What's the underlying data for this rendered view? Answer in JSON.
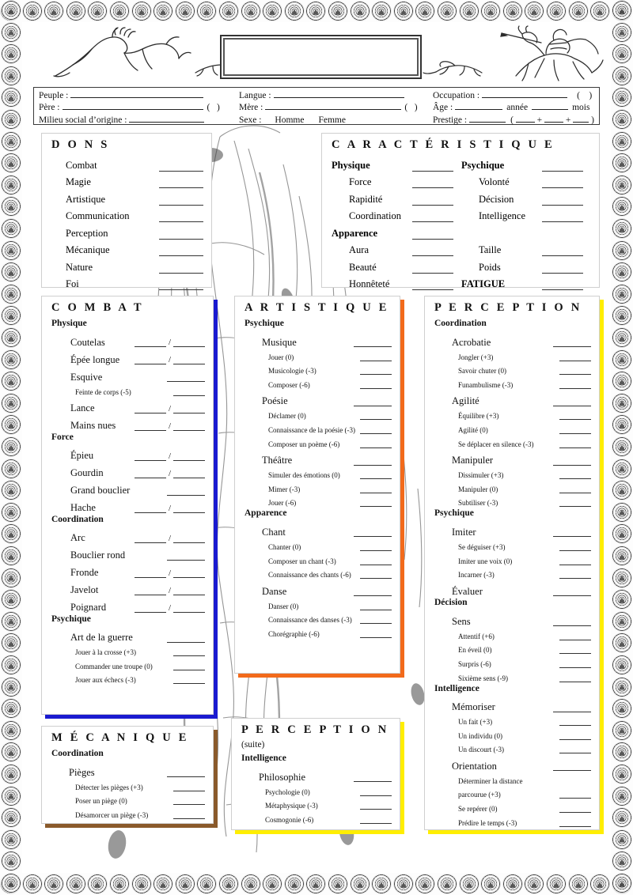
{
  "header": {
    "title_box_text": "",
    "art_left": "running-stag-line-art",
    "art_center_small": "running-dogs-line-art",
    "art_right": "mounted-knight-line-art"
  },
  "identity": {
    "rows": [
      [
        {
          "label": "Peuple :",
          "blank": "long"
        },
        {
          "label": "Langue :",
          "blank": "long"
        },
        {
          "label": "Occupation :",
          "blank": "med",
          "paren": true
        }
      ],
      [
        {
          "label": "Père :",
          "blank": "long",
          "paren": true
        },
        {
          "label": "Mère :",
          "blank": "long",
          "paren": true
        },
        {
          "label": "Âge :",
          "blank": "short",
          "suffix1": "année",
          "suffix2": "mois"
        }
      ],
      [
        {
          "label": "Milieu social d’origine :",
          "blank": "med"
        },
        {
          "label": "Sexe :",
          "options": [
            "Homme",
            "Femme"
          ]
        },
        {
          "label": "Prestige :",
          "formula": "( ___ + ___ + ___ )"
        }
      ]
    ],
    "sexe_label": "Sexe :",
    "sexe_options": [
      "Homme",
      "Femme"
    ],
    "annee": "année",
    "mois": "mois",
    "prestige_label": "Prestige :"
  },
  "dons": {
    "title": "D O N S",
    "items": [
      "Combat",
      "Magie",
      "Artistique",
      "Communication",
      "Perception",
      "Mécanique",
      "Nature",
      "Foi"
    ]
  },
  "caracteristique": {
    "title": "C A R A C T É R I S T I Q U E",
    "rows": [
      {
        "left": "Physique",
        "left_bold": true,
        "left_indent": false,
        "right": "Psychique",
        "right_bold": true,
        "right_indent": false,
        "right_blank": true
      },
      {
        "left": "Force",
        "left_bold": false,
        "left_indent": true,
        "right": "Volonté",
        "right_bold": false,
        "right_indent": true,
        "right_blank": true
      },
      {
        "left": "Rapidité",
        "left_bold": false,
        "left_indent": true,
        "right": "Décision",
        "right_bold": false,
        "right_indent": true,
        "right_blank": true
      },
      {
        "left": "Coordination",
        "left_bold": false,
        "left_indent": true,
        "right": "Intelligence",
        "right_bold": false,
        "right_indent": true,
        "right_blank": true
      },
      {
        "left": "Apparence",
        "left_bold": true,
        "left_indent": false,
        "right": "",
        "right_bold": false,
        "right_indent": false,
        "right_blank": false
      },
      {
        "left": "Aura",
        "left_bold": false,
        "left_indent": true,
        "right": "Taille",
        "right_bold": false,
        "right_indent": true,
        "right_blank": true
      },
      {
        "left": "Beauté",
        "left_bold": false,
        "left_indent": true,
        "right": "Poids",
        "right_bold": false,
        "right_indent": true,
        "right_blank": true
      },
      {
        "left": "Honnêteté",
        "left_bold": false,
        "left_indent": true,
        "right": "FATIGUE",
        "right_bold": true,
        "right_indent": false,
        "right_blank": true
      }
    ]
  },
  "combat": {
    "title": "C O M B A T",
    "shadow_color": "#1a1ad0",
    "groups": [
      {
        "name": "Physique",
        "entries": [
          {
            "label": "Coutelas",
            "level": 1,
            "dual": true
          },
          {
            "label": "Épée longue",
            "level": 1,
            "dual": true
          },
          {
            "label": "Esquive",
            "level": 1,
            "dual": false
          },
          {
            "label": "Feinte de corps (-5)",
            "level": 2,
            "dual": false
          },
          {
            "label": "Lance",
            "level": 1,
            "dual": true
          },
          {
            "label": "Mains nues",
            "level": 1,
            "dual": true
          }
        ]
      },
      {
        "name": "Force",
        "entries": [
          {
            "label": "Épieu",
            "level": 1,
            "dual": true
          },
          {
            "label": "Gourdin",
            "level": 1,
            "dual": true
          },
          {
            "label": "Grand bouclier",
            "level": 1,
            "dual": false
          },
          {
            "label": "Hache",
            "level": 1,
            "dual": true
          }
        ]
      },
      {
        "name": "Coordination",
        "entries": [
          {
            "label": "Arc",
            "level": 1,
            "dual": true
          },
          {
            "label": "Bouclier rond",
            "level": 1,
            "dual": false
          },
          {
            "label": "Fronde",
            "level": 1,
            "dual": true
          },
          {
            "label": "Javelot",
            "level": 1,
            "dual": true
          },
          {
            "label": "Poignard",
            "level": 1,
            "dual": true
          }
        ]
      },
      {
        "name": "Psychique",
        "entries": [
          {
            "label": "Art de la guerre",
            "level": 1,
            "dual": false
          },
          {
            "label": "Jouer à la crosse (+3)",
            "level": 2,
            "dual": false
          },
          {
            "label": "Commander une troupe (0)",
            "level": 2,
            "dual": false
          },
          {
            "label": "Jouer aux échecs (-3)",
            "level": 2,
            "dual": false
          }
        ]
      }
    ]
  },
  "artistique": {
    "title": "A R T I S T I Q U E",
    "shadow_color": "#f26a1b",
    "groups": [
      {
        "name": "Psychique",
        "entries": [
          {
            "label": "Musique",
            "level": 1,
            "dual": false
          },
          {
            "label": "Jouer (0)",
            "level": 2,
            "dual": false
          },
          {
            "label": "Musicologie (-3)",
            "level": 2,
            "dual": false
          },
          {
            "label": "Composer (-6)",
            "level": 2,
            "dual": false
          },
          {
            "label": "Poésie",
            "level": 1,
            "dual": false
          },
          {
            "label": "Déclamer (0)",
            "level": 2,
            "dual": false
          },
          {
            "label": "Connaissance de la poésie (-3)",
            "level": 2,
            "dual": false
          },
          {
            "label": "Composer un poème (-6)",
            "level": 2,
            "dual": false
          },
          {
            "label": "Théâtre",
            "level": 1,
            "dual": false
          },
          {
            "label": "Simuler des émotions (0)",
            "level": 2,
            "dual": false
          },
          {
            "label": "Mimer (-3)",
            "level": 2,
            "dual": false
          },
          {
            "label": "Jouer (-6)",
            "level": 2,
            "dual": false
          }
        ]
      },
      {
        "name": "Apparence",
        "entries": [
          {
            "label": "Chant",
            "level": 1,
            "dual": false
          },
          {
            "label": "Chanter (0)",
            "level": 2,
            "dual": false
          },
          {
            "label": "Composer un chant (-3)",
            "level": 2,
            "dual": false
          },
          {
            "label": "Connaissance des chants (-6)",
            "level": 2,
            "dual": false
          },
          {
            "label": "Danse",
            "level": 1,
            "dual": false
          },
          {
            "label": "Danser (0)",
            "level": 2,
            "dual": false
          },
          {
            "label": "Connaissance des danses (-3)",
            "level": 2,
            "dual": false
          },
          {
            "label": "Chorégraphie (-6)",
            "level": 2,
            "dual": false
          }
        ]
      }
    ]
  },
  "perception": {
    "title": "P E R C E P T I O N",
    "shadow_color": "#ffee00",
    "groups": [
      {
        "name": "Coordination",
        "entries": [
          {
            "label": "Acrobatie",
            "level": 1,
            "dual": false
          },
          {
            "label": "Jongler (+3)",
            "level": 2,
            "dual": false
          },
          {
            "label": "Savoir chuter (0)",
            "level": 2,
            "dual": false
          },
          {
            "label": "Funambulisme (-3)",
            "level": 2,
            "dual": false
          },
          {
            "label": "Agilité",
            "level": 1,
            "dual": false
          },
          {
            "label": "Équilibre (+3)",
            "level": 2,
            "dual": false
          },
          {
            "label": "Agilité (0)",
            "level": 2,
            "dual": false
          },
          {
            "label": "Se déplacer en silence (-3)",
            "level": 2,
            "dual": false
          },
          {
            "label": "Manipuler",
            "level": 1,
            "dual": false
          },
          {
            "label": "Dissimuler (+3)",
            "level": 2,
            "dual": false
          },
          {
            "label": "Manipuler (0)",
            "level": 2,
            "dual": false
          },
          {
            "label": "Subtiliser (-3)",
            "level": 2,
            "dual": false
          }
        ]
      },
      {
        "name": "Psychique",
        "entries": [
          {
            "label": "Imiter",
            "level": 1,
            "dual": false
          },
          {
            "label": "Se déguiser (+3)",
            "level": 2,
            "dual": false
          },
          {
            "label": "Imiter une voix (0)",
            "level": 2,
            "dual": false
          },
          {
            "label": "Incarner (-3)",
            "level": 2,
            "dual": false
          },
          {
            "label": "Évaluer",
            "level": 1,
            "dual": false
          }
        ]
      },
      {
        "name": "Décision",
        "entries": [
          {
            "label": "Sens",
            "level": 1,
            "dual": false
          },
          {
            "label": "Attentif (+6)",
            "level": 2,
            "dual": false
          },
          {
            "label": "En éveil (0)",
            "level": 2,
            "dual": false
          },
          {
            "label": "Surpris (-6)",
            "level": 2,
            "dual": false
          },
          {
            "label": "Sixième sens (-9)",
            "level": 2,
            "dual": false
          }
        ]
      },
      {
        "name": "Intelligence",
        "entries": [
          {
            "label": "Mémoriser",
            "level": 1,
            "dual": false
          },
          {
            "label": "Un fait (+3)",
            "level": 2,
            "dual": false
          },
          {
            "label": "Un individu (0)",
            "level": 2,
            "dual": false
          },
          {
            "label": "Un discourt (-3)",
            "level": 2,
            "dual": false
          },
          {
            "label": "Orientation",
            "level": 1,
            "dual": false
          },
          {
            "label": "Déterminer la distance",
            "level": 2,
            "dual": false,
            "noblank": true
          },
          {
            "label": "parcourue (+3)",
            "level": 2,
            "dual": false
          },
          {
            "label": "Se repérer (0)",
            "level": 2,
            "dual": false
          },
          {
            "label": "Prédire le temps (-3)",
            "level": 2,
            "dual": false
          }
        ]
      }
    ]
  },
  "mecanique": {
    "title": "M É C A N I Q U E",
    "shadow_color": "#8a5a2b",
    "groups": [
      {
        "name": "Coordination",
        "entries": [
          {
            "label": "Pièges",
            "level": 1,
            "dual": false
          },
          {
            "label": "Détecter les pièges (+3)",
            "level": 2,
            "dual": false
          },
          {
            "label": "Poser un piège (0)",
            "level": 2,
            "dual": false
          },
          {
            "label": "Désamorcer un piège (-3)",
            "level": 2,
            "dual": false
          }
        ]
      }
    ]
  },
  "perception_suite": {
    "title": "P E R C E P T I O N",
    "subtitle": "(suite)",
    "shadow_color": "#ffee00",
    "groups": [
      {
        "name": "Intelligence",
        "entries": [
          {
            "label": "Philosophie",
            "level": 1,
            "dual": false
          },
          {
            "label": "Psychologie (0)",
            "level": 2,
            "dual": false
          },
          {
            "label": "Métaphysique (-3)",
            "level": 2,
            "dual": false
          },
          {
            "label": "Cosmogonie (-6)",
            "level": 2,
            "dual": false
          }
        ]
      }
    ]
  },
  "colors": {
    "blue": "#1a1ad0",
    "orange": "#f26a1b",
    "yellow": "#ffee00",
    "brown": "#8a5a2b",
    "ink": "#111111"
  }
}
